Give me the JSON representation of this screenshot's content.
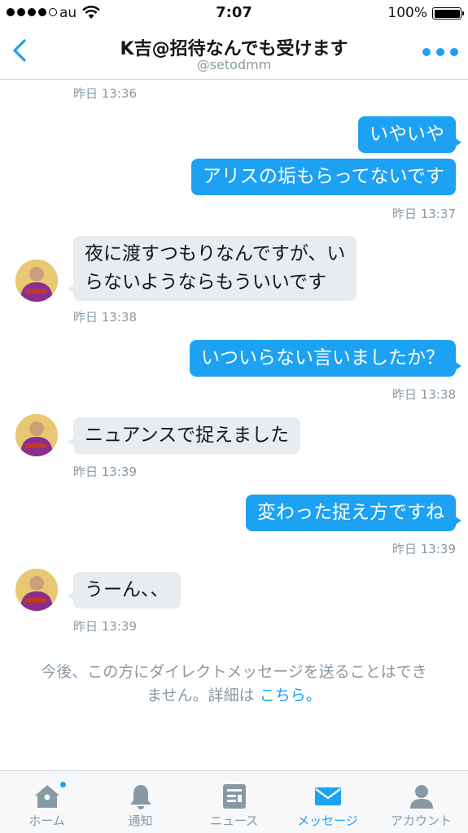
{
  "status": {
    "carrier": "au",
    "time": "7:07",
    "battery": "100%"
  },
  "header": {
    "title": "K吉@招待なんでも受けます",
    "subtitle": "@setodmm"
  },
  "messages": [
    {
      "from": "them",
      "time": "昨日 13:36"
    },
    {
      "from": "me",
      "lines": [
        "いやいや",
        "アリスの垢もらってないです"
      ],
      "time": "昨日 13:37"
    },
    {
      "from": "them",
      "text_1": "夜に渡すつもりなんですが、い",
      "text_2": "らないようならもういいです",
      "time": "昨日 13:38"
    },
    {
      "from": "me",
      "text": "いついらない言いましたか？",
      "time": "昨日 13:38"
    },
    {
      "from": "them",
      "text": "ニュアンスで捉えました",
      "time": "昨日 13:39"
    },
    {
      "from": "me",
      "text": "変わった捉え方ですね",
      "time": "昨日 13:39"
    },
    {
      "from": "them",
      "text": "うーん、、",
      "time": "昨日 13:39"
    }
  ],
  "notice": {
    "line_1": "今後、この方にダイレクトメッセージを送ることはでき",
    "line_2": "ません。詳細は",
    "link": "こちら。"
  },
  "tabs": [
    {
      "label": "ホーム",
      "icon": "home-icon",
      "badge": true
    },
    {
      "label": "通知",
      "icon": "bell-icon"
    },
    {
      "label": "ニュース",
      "icon": "news-icon"
    },
    {
      "label": "メッセージ",
      "icon": "envelope-icon",
      "active": true
    },
    {
      "label": "アカウント",
      "icon": "person-icon"
    }
  ],
  "colors": {
    "accent": "#1da1f2",
    "bubble_other": "#e6ecf0",
    "muted": "#8899a6"
  }
}
